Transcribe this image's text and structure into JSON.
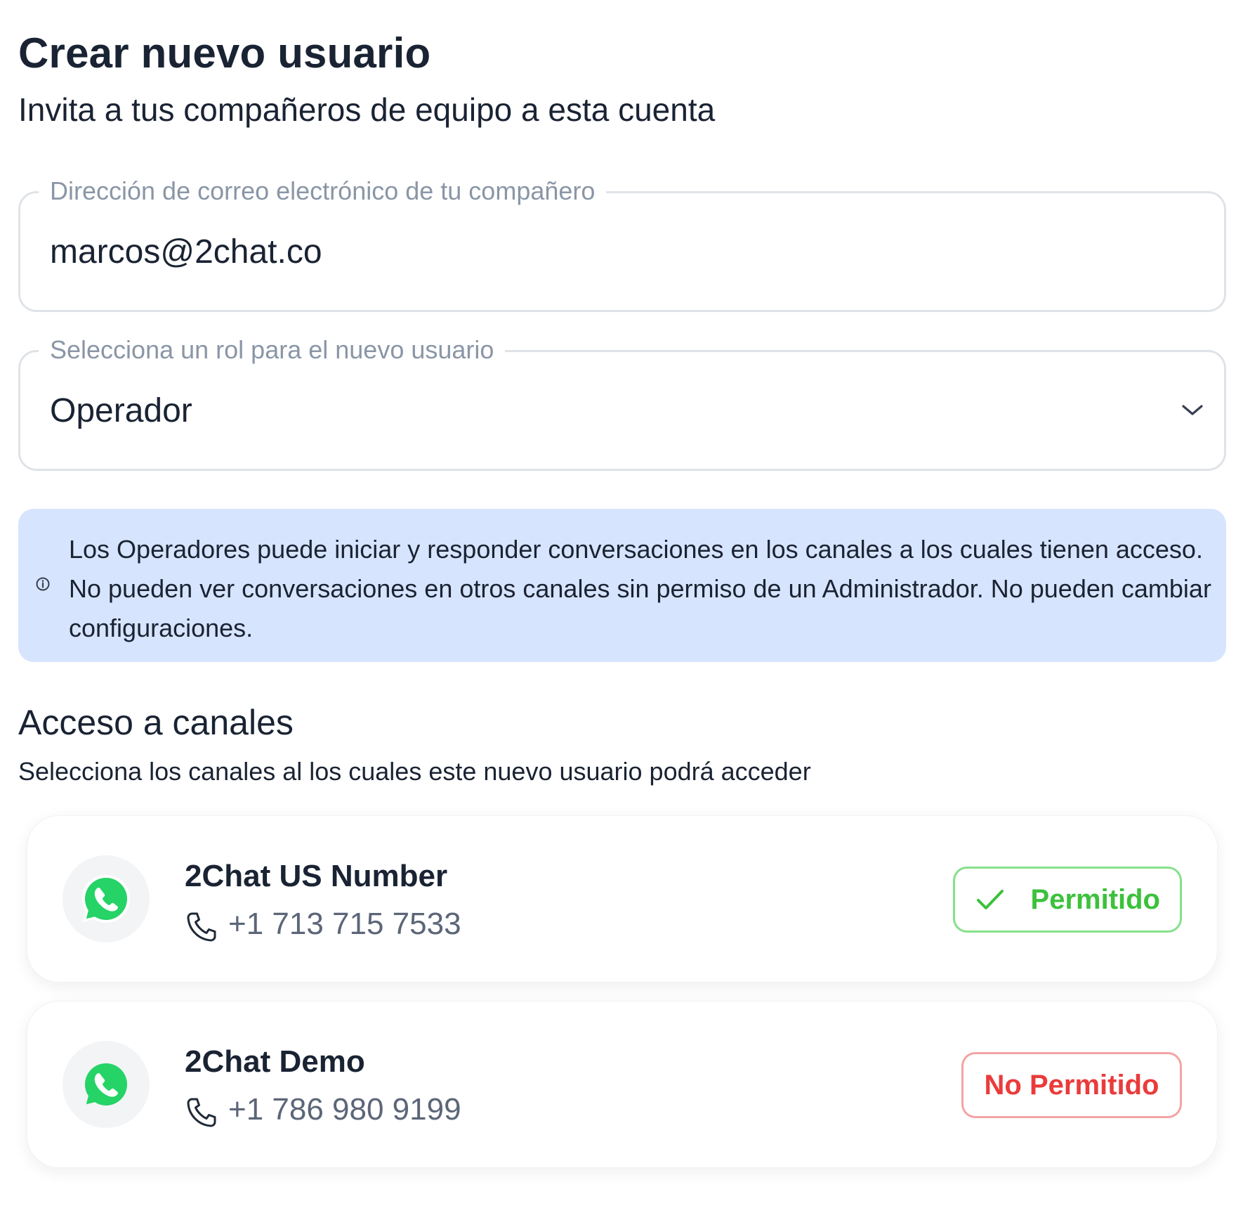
{
  "header": {
    "title": "Crear nuevo usuario",
    "subtitle": "Invita a tus compañeros de equipo a esta cuenta"
  },
  "email_field": {
    "label": "Dirección de correo electrónico de tu compañero",
    "value": "marcos@2chat.co"
  },
  "role_field": {
    "label": "Selecciona un rol para el nuevo usuario",
    "value": "Operador",
    "icon": "chevron-down-icon"
  },
  "info_alert": {
    "icon": "info-icon",
    "text": "Los Operadores puede iniciar y responder conversaciones en los canales a los cuales tienen acceso. No pueden ver conversaciones en otros canales sin permiso de un Administrador. No pueden cambiar configuraciones.",
    "background": "#d7e4fd"
  },
  "channel_access": {
    "title": "Acceso a canales",
    "subtitle": "Selecciona los canales al los cuales este nuevo usuario podrá acceder",
    "channels": [
      {
        "name": "2Chat US Number",
        "phone": "+1 713 715 7533",
        "icon": "whatsapp-icon",
        "status_label": "Permitido",
        "status": "allowed",
        "status_color": "#3cc13b"
      },
      {
        "name": "2Chat Demo",
        "phone": "+1 786 980 9199",
        "icon": "whatsapp-icon",
        "status_label": "No Permitido",
        "status": "denied",
        "status_color": "#ea3b3b"
      }
    ]
  },
  "colors": {
    "text": "#1a2333",
    "muted": "#8a96a6",
    "whatsapp": "#25d366",
    "allowed": "#3cc13b",
    "denied": "#ea3b3b"
  }
}
